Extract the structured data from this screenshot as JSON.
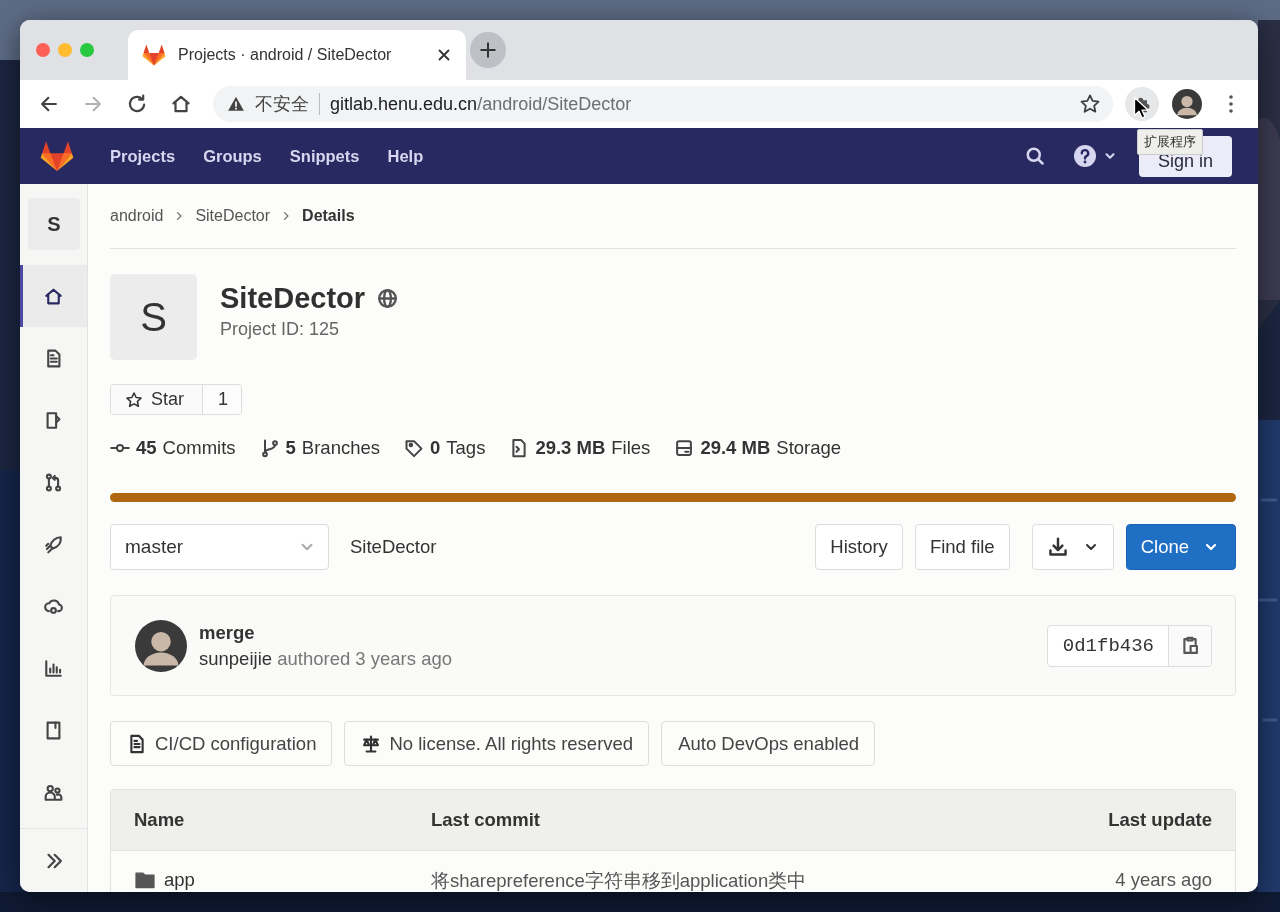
{
  "tabs": [
    {
      "title": "Projects · android / SiteDector",
      "selected": true
    }
  ],
  "nav_buttons": [
    {
      "kind": "back",
      "disabled": false
    },
    {
      "kind": "forward",
      "disabled": true
    },
    {
      "kind": "reload",
      "disabled": false
    },
    {
      "kind": "home",
      "disabled": false
    }
  ],
  "address_bar": {
    "security_label": "不安全",
    "host": "gitlab.henu.edu.cn",
    "path": "/android/SiteDector"
  },
  "tooltip": "扩展程序",
  "top_nav": {
    "items": [
      "Projects",
      "Groups",
      "Snippets",
      "Help"
    ],
    "sign_in": "Sign in"
  },
  "sidebar": {
    "project_letter": "S",
    "items": [
      {
        "kind": "home",
        "selected": true
      },
      {
        "kind": "repository",
        "selected": false
      },
      {
        "kind": "issues",
        "selected": false
      },
      {
        "kind": "merge_requests",
        "selected": false
      },
      {
        "kind": "ci_cd",
        "selected": false
      },
      {
        "kind": "operations",
        "selected": false
      },
      {
        "kind": "analytics",
        "selected": false
      },
      {
        "kind": "wiki",
        "selected": false
      },
      {
        "kind": "members",
        "selected": false
      }
    ]
  },
  "breadcrumb": [
    {
      "label": "android",
      "current": false
    },
    {
      "label": "SiteDector",
      "current": false
    },
    {
      "label": "Details",
      "current": true
    }
  ],
  "project": {
    "avatar_letter": "S",
    "name": "SiteDector",
    "id_text": "Project ID: 125",
    "star_label": "Star",
    "star_count": "1"
  },
  "stats": [
    {
      "kind": "commits",
      "value": "45",
      "label": "Commits"
    },
    {
      "kind": "branches",
      "value": "5",
      "label": "Branches"
    },
    {
      "kind": "tags",
      "value": "0",
      "label": "Tags"
    },
    {
      "kind": "files",
      "value": "29.3 MB",
      "label": "Files"
    },
    {
      "kind": "storage",
      "value": "29.4 MB",
      "label": "Storage"
    }
  ],
  "languages": [
    {
      "color": "#b0670f",
      "level": 1
    }
  ],
  "repo_bar": {
    "branch": "master",
    "path": "SiteDector",
    "buttons": [
      "History",
      "Find file"
    ],
    "clone": "Clone"
  },
  "last_commit": {
    "title": "merge",
    "author": "sunpeijie",
    "meta": "authored 3 years ago",
    "sha": "0d1fb436"
  },
  "badges": [
    {
      "kind": "ci",
      "label": "CI/CD configuration"
    },
    {
      "kind": "license",
      "label": "No license. All rights reserved"
    },
    {
      "kind": "plain",
      "label": "Auto DevOps enabled"
    }
  ],
  "table": {
    "columns": [
      "Name",
      "Last commit",
      "Last update"
    ],
    "rows": [
      {
        "kind": "folder",
        "name": "app",
        "last_commit": "将sharepreference字符串移到application类中",
        "last_update": "4 years ago"
      }
    ]
  }
}
